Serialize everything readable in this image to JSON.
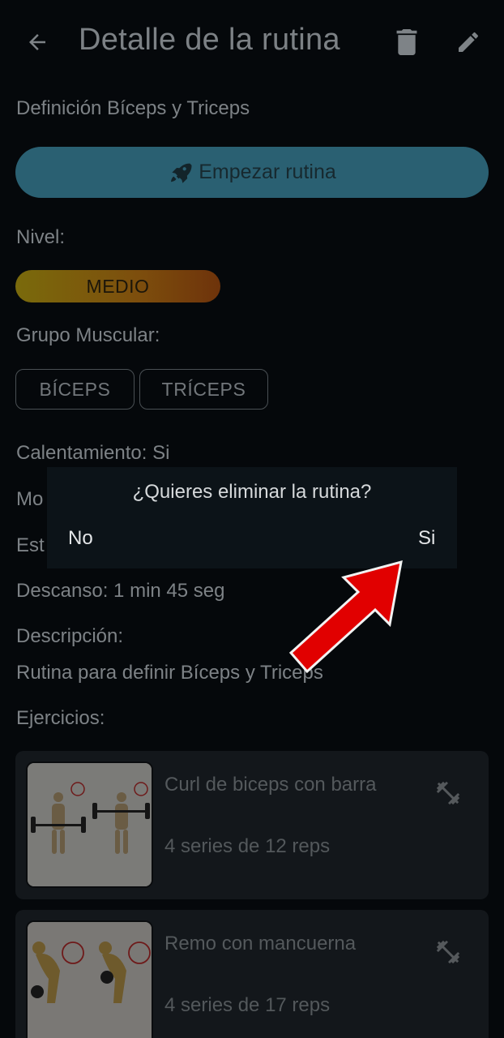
{
  "header": {
    "title": "Detalle de la rutina",
    "back_icon": "arrow-left-icon",
    "delete_icon": "trash-icon",
    "edit_icon": "pencil-icon"
  },
  "routine": {
    "name": "Definición Bíceps y Triceps",
    "start_button": "Empezar rutina",
    "start_icon": "rocket-icon",
    "level_label": "Nivel:",
    "level_value": "MEDIO",
    "muscle_group_label": "Grupo Muscular:",
    "muscle_groups": [
      "BÍCEPS",
      "TRÍCEPS"
    ],
    "warmup": "Calentamiento:  Si",
    "mode_partial": "Mo",
    "style_partial": "Est",
    "rest": "Descanso: 1 min 45 seg",
    "description_label": "Descripción:",
    "description": "Rutina para definir Bíceps y Triceps",
    "exercises_label": "Ejercicios:"
  },
  "exercises": [
    {
      "name": "Curl de biceps con barra",
      "detail": "4 series de 12 reps",
      "icon": "dumbbell-icon"
    },
    {
      "name": "Remo con mancuerna",
      "detail": "4 series de 17 reps",
      "icon": "dumbbell-icon"
    }
  ],
  "dialog": {
    "message": "¿Quieres eliminar la rutina?",
    "no_label": "No",
    "yes_label": "Si"
  },
  "colors": {
    "background": "#05080b",
    "start_button": "#2a6072",
    "level_badge": "#7d4e0d",
    "annotation_arrow": "#e10000"
  }
}
